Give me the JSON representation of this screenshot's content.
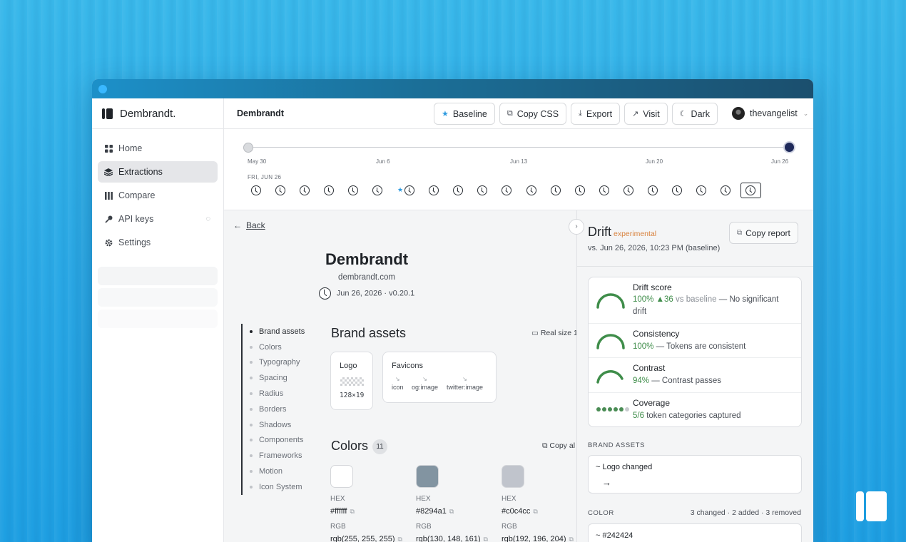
{
  "app": {
    "name": "Dembrandt."
  },
  "sidebar": {
    "items": [
      {
        "label": "Home",
        "icon": "grid-icon"
      },
      {
        "label": "Extractions",
        "icon": "layers-icon"
      },
      {
        "label": "Compare",
        "icon": "columns-icon"
      },
      {
        "label": "API keys",
        "icon": "key-icon"
      },
      {
        "label": "Settings",
        "icon": "gear-icon"
      }
    ]
  },
  "topbar": {
    "crumb": "Dembrandt",
    "buttons": [
      {
        "label": "Baseline",
        "icon": "star-icon"
      },
      {
        "label": "Copy CSS",
        "icon": "copy-icon"
      },
      {
        "label": "Export",
        "icon": "download-icon"
      },
      {
        "label": "Visit",
        "icon": "external-link-icon"
      },
      {
        "label": "Dark",
        "icon": "moon-icon"
      }
    ],
    "user": "thevangelist"
  },
  "timeline": {
    "labels": [
      "May 30",
      "Jun 6",
      "Jun 13",
      "Jun 20",
      "Jun 26"
    ],
    "day_label": "FRI, JUN 26"
  },
  "site": {
    "back": "Back",
    "title": "Dembrandt",
    "domain": "dembrandt.com",
    "meta": "Jun 26, 2026 · v0.20.1"
  },
  "toc": [
    "Brand assets",
    "Colors",
    "Typography",
    "Spacing",
    "Radius",
    "Borders",
    "Shadows",
    "Components",
    "Frameworks",
    "Motion",
    "Icon System"
  ],
  "brand_assets": {
    "title": "Brand assets",
    "real_size": "Real size 1:",
    "logo": {
      "title": "Logo",
      "size": "128×19"
    },
    "favicons": {
      "title": "Favicons",
      "items": [
        "icon",
        "og:image",
        "twitter:image"
      ]
    }
  },
  "colors": {
    "title": "Colors",
    "count": "11",
    "copy_all": "Copy al",
    "hex_label": "HEX",
    "rgb_label": "RGB",
    "swatches": [
      {
        "hex": "#ffffff",
        "rgb": "rgb(255, 255, 255)"
      },
      {
        "hex": "#8294a1",
        "rgb": "rgb(130, 148, 161)"
      },
      {
        "hex": "#c0c4cc",
        "rgb": "rgb(192, 196, 204)"
      }
    ]
  },
  "drift": {
    "title": "Drift",
    "tag": "experimental",
    "subtitle": "vs. Jun 26, 2026, 10:23 PM (baseline)",
    "copy_report": "Copy report",
    "scores": [
      {
        "name": "Drift score",
        "value": "100%",
        "delta": "▲36",
        "suffix_muted": "vs baseline",
        "rest": "— No significant drift"
      },
      {
        "name": "Consistency",
        "value": "100%",
        "rest": "— Tokens are consistent"
      },
      {
        "name": "Contrast",
        "value": "94%",
        "rest": "— Contrast passes"
      },
      {
        "name": "Coverage",
        "value": "5/6",
        "rest": "token categories captured",
        "dots_on": 5,
        "dots_total": 6
      }
    ],
    "brand_section": "BRAND ASSETS",
    "brand_change": "~ Logo changed",
    "brand_arrow": "→",
    "color_section": "COLOR",
    "color_summary": "3 changed · 2 added · 3 removed",
    "color_change": "~ #242424"
  },
  "colors_theme": {
    "accent": "#2e9be0",
    "good": "#3f8d4a",
    "warn": "#d8823e"
  }
}
